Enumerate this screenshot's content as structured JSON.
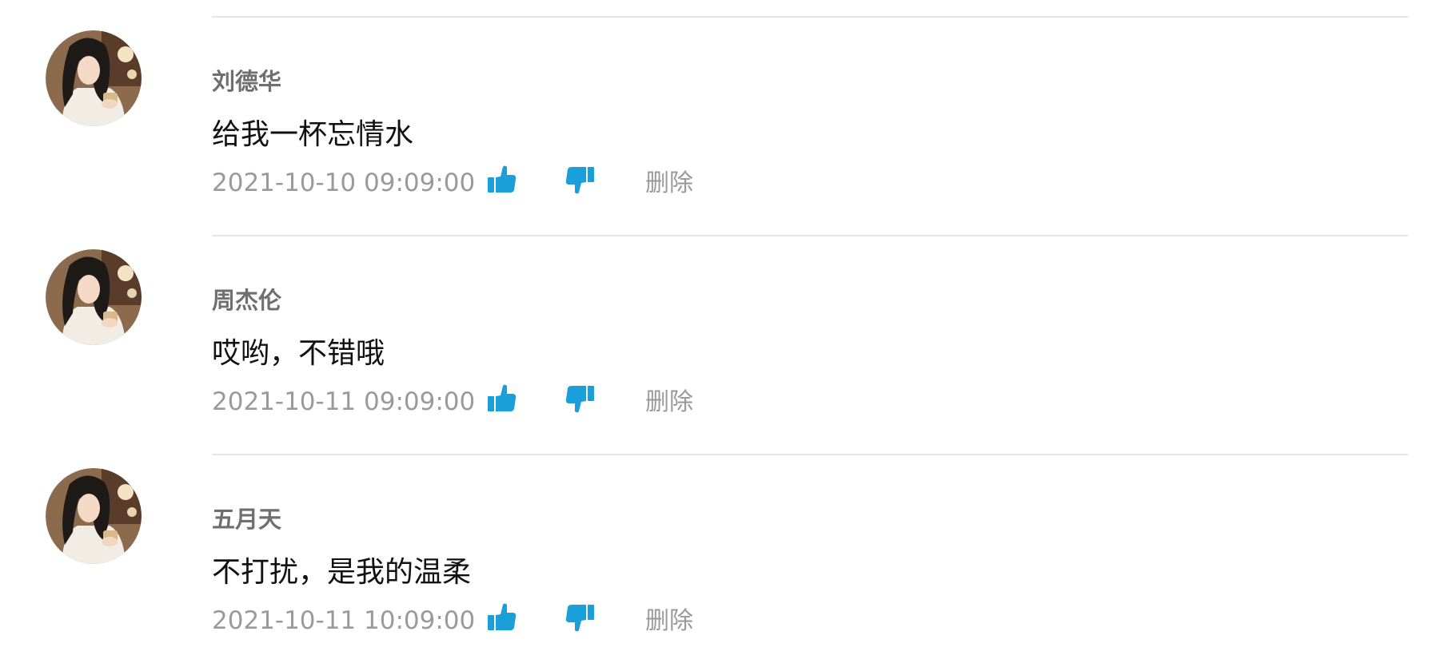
{
  "colors": {
    "accent": "#1a9fd8",
    "meta_text": "#9a9a9a",
    "author_text": "#6f6f6f",
    "divider": "#e5e5e5"
  },
  "icons": {
    "like": "thumbs-up-icon",
    "dislike": "thumbs-down-icon"
  },
  "comments": [
    {
      "author": "刘德华",
      "content": "给我一杯忘情水",
      "time": "2021-10-10 09:09:00",
      "delete_label": "删除"
    },
    {
      "author": "周杰伦",
      "content": "哎哟，不错哦",
      "time": "2021-10-11 09:09:00",
      "delete_label": "删除"
    },
    {
      "author": "五月天",
      "content": "不打扰，是我的温柔",
      "time": "2021-10-11 10:09:00",
      "delete_label": "删除"
    }
  ]
}
